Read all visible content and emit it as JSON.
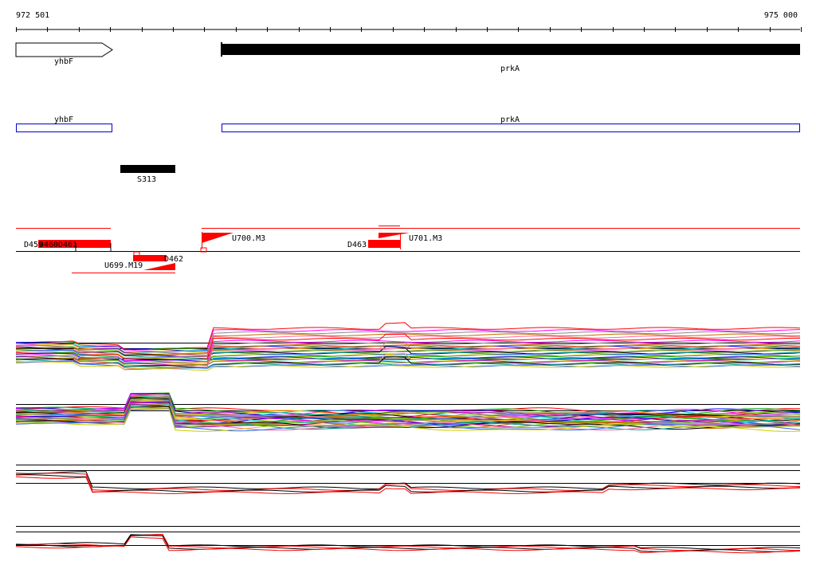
{
  "coordinates": {
    "start": "972 501",
    "end": "975 000"
  },
  "genes": [
    {
      "name": "yhbF",
      "strand": "+",
      "color": "#ffffff"
    },
    {
      "name": "prkA",
      "strand": "+",
      "color": "#000000"
    }
  ],
  "annotations": [
    {
      "name": "yhbF",
      "color": "#0000cc"
    },
    {
      "name": "prkA",
      "color": "#0000cc"
    }
  ],
  "segments": [
    {
      "name": "S313",
      "color": "#000000"
    }
  ],
  "features": {
    "top_labels": [
      "D459",
      "D460",
      "D461",
      "U700.M3",
      "D463",
      "U701.M3"
    ],
    "bottom_labels": [
      "U699.M19",
      "D462"
    ],
    "feature_color": "#ff0000"
  },
  "colors": {
    "accent": "#ff0000",
    "axis": "#000000",
    "profile_palette": [
      "#ff0000",
      "#00aa00",
      "#0000ff",
      "#ff00ff",
      "#00cccc",
      "#ffaa00",
      "#888888",
      "#aa00aa",
      "#66cc00",
      "#cc6600",
      "#000000",
      "#009999",
      "#ff6699",
      "#3366ff",
      "#cccc00"
    ]
  }
}
